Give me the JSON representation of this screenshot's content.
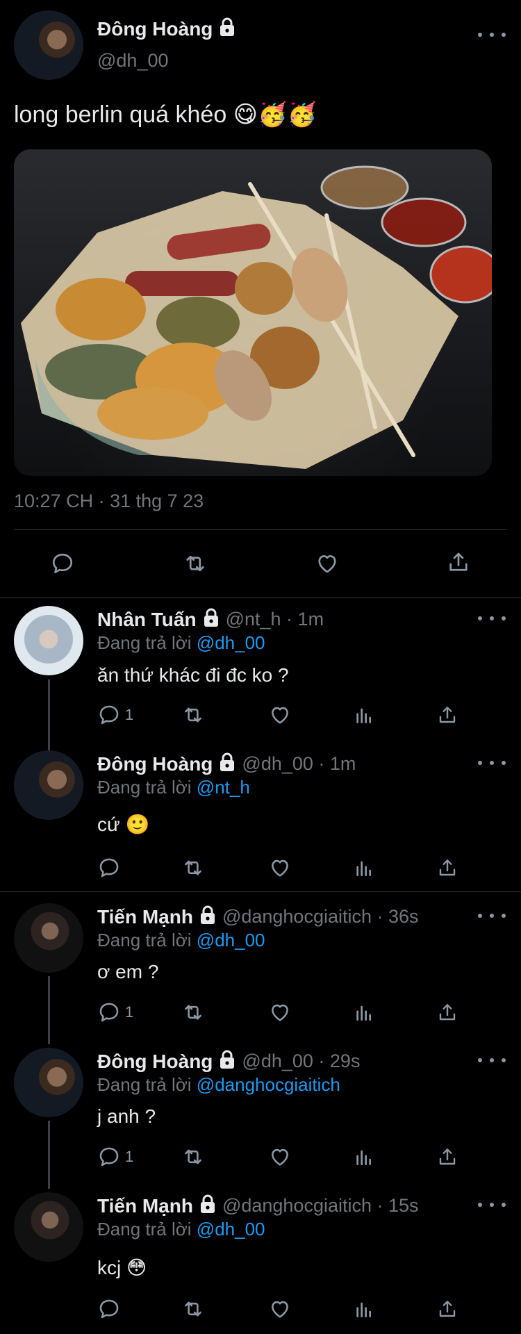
{
  "main_tweet": {
    "name": "Đông Hoàng",
    "handle": "@dh_00",
    "text": "long berlin quá khéo 😋🥳🥳",
    "timestamp": "10:27 CH · 31 thg 7 23",
    "actions": [
      "reply-icon",
      "retweet-icon",
      "like-icon",
      "share-icon"
    ]
  },
  "replies": [
    {
      "name": "Nhân Tuấn",
      "handle_time": "@nt_h · 1m",
      "reply_prefix": "Đang trả lời",
      "reply_to": "@dh_00",
      "text": "ăn thứ khác đi đc ko ?",
      "reply_count": "1"
    },
    {
      "name": "Đông Hoàng",
      "handle_time": "@dh_00 · 1m",
      "reply_prefix": "Đang trả lời",
      "reply_to": "@nt_h",
      "text": "cứ 🙂",
      "reply_count": ""
    },
    {
      "name": "Tiến Mạnh",
      "handle_time": "@danghocgiaitich · 36s",
      "reply_prefix": "Đang trả lời",
      "reply_to": "@dh_00",
      "text": "ơ em ?",
      "reply_count": "1"
    },
    {
      "name": "Đông Hoàng",
      "handle_time": "@dh_00 · 29s",
      "reply_prefix": "Đang trả lời",
      "reply_to": "@danghocgiaitich",
      "text": "j anh ?",
      "reply_count": "1"
    },
    {
      "name": "Tiến Mạnh",
      "handle_time": "@danghocgiaitich · 15s",
      "reply_prefix": "Đang trả lời",
      "reply_to": "@dh_00",
      "text": "kcj 😳",
      "reply_count": ""
    }
  ],
  "colors": {
    "background": "#000000",
    "text": "#e7e9ea",
    "muted": "#71767b",
    "link": "#1d9bf0"
  },
  "icons": [
    "lock-icon",
    "more-icon",
    "reply-icon",
    "retweet-icon",
    "like-icon",
    "analytics-icon",
    "share-icon"
  ]
}
